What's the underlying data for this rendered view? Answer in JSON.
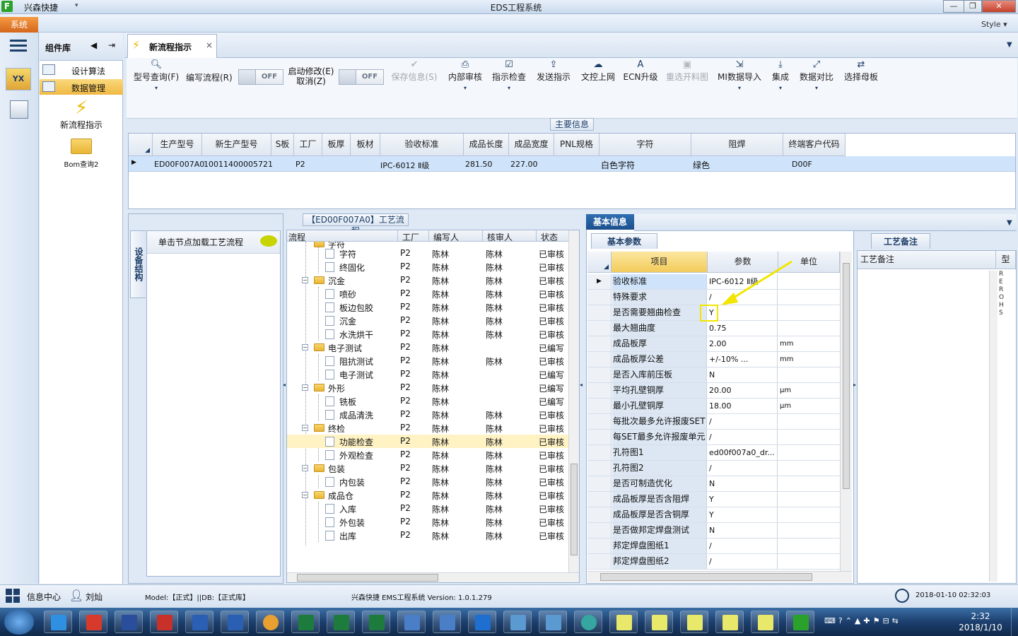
{
  "window": {
    "app_name": "兴森快捷",
    "title": "EDS工程系统",
    "btn_min": "—",
    "btn_max": "❐",
    "btn_close": "✕"
  },
  "menubar": {
    "system_label": "系统",
    "style_label": "Style"
  },
  "component_panel": {
    "title": "组件库",
    "items": [
      {
        "label": "设计算法"
      },
      {
        "label": "数据管理"
      }
    ],
    "tools": [
      {
        "label": "新流程指示"
      },
      {
        "label": "Bom查询2"
      }
    ]
  },
  "tab": {
    "label": "新流程指示",
    "close": "×"
  },
  "toolbar": {
    "buttons": [
      {
        "label": "型号查询(F)"
      },
      {
        "label": "编写流程(R)"
      },
      {
        "label": "启动修改(E)"
      },
      {
        "label": "取消(Z)"
      },
      {
        "label": "保存信息(S)"
      },
      {
        "label": "内部审核"
      },
      {
        "label": "指示检查"
      },
      {
        "label": "发送指示"
      },
      {
        "label": "文控上网"
      },
      {
        "label": "ECN升级"
      },
      {
        "label": "重选开料图"
      },
      {
        "label": "MI数据导入"
      },
      {
        "label": "集成"
      },
      {
        "label": "数据对比"
      },
      {
        "label": "选择母板"
      }
    ],
    "toggle_off": "OFF"
  },
  "main_info": {
    "caption": "主要信息",
    "columns": [
      "生产型号",
      "新生产型号",
      "S板",
      "工厂",
      "板厚",
      "板材",
      "验收标准",
      "成品长度",
      "成品宽度",
      "PNL规格",
      "字符",
      "阻焊",
      "终端客户代码"
    ],
    "row": [
      "ED00F007A0",
      "10011400005721",
      "",
      "P2",
      "",
      "",
      "IPC-6012 Ⅱ级",
      "281.50",
      "227.00",
      "",
      "白色字符",
      "绿色",
      "D00F"
    ]
  },
  "process": {
    "caption": "【ED00F007A0】工艺流程",
    "vertical_tab": "设备结构",
    "node_hint": "单击节点加载工艺流程",
    "columns": [
      "流程",
      "工厂",
      "编写人",
      "核审人",
      "状态"
    ],
    "rows": [
      {
        "name": "字符",
        "factory": "P2",
        "writer": "陈林",
        "reviewer": "陈林",
        "status": "已审核"
      },
      {
        "name": "终固化",
        "factory": "P2",
        "writer": "陈林",
        "reviewer": "陈林",
        "status": "已审核"
      },
      {
        "name": "沉金",
        "factory": "P2",
        "writer": "陈林",
        "reviewer": "陈林",
        "status": "已审核"
      },
      {
        "name": "喷砂",
        "factory": "P2",
        "writer": "陈林",
        "reviewer": "陈林",
        "status": "已审核"
      },
      {
        "name": "板边包胶",
        "factory": "P2",
        "writer": "陈林",
        "reviewer": "陈林",
        "status": "已审核"
      },
      {
        "name": "沉金",
        "factory": "P2",
        "writer": "陈林",
        "reviewer": "陈林",
        "status": "已审核"
      },
      {
        "name": "水洗烘干",
        "factory": "P2",
        "writer": "陈林",
        "reviewer": "陈林",
        "status": "已审核"
      },
      {
        "name": "电子测试",
        "factory": "P2",
        "writer": "陈林",
        "reviewer": "",
        "status": "已编写"
      },
      {
        "name": "阻抗测试",
        "factory": "P2",
        "writer": "陈林",
        "reviewer": "陈林",
        "status": "已审核"
      },
      {
        "name": "电子测试",
        "factory": "P2",
        "writer": "陈林",
        "reviewer": "",
        "status": "已编写"
      },
      {
        "name": "外形",
        "factory": "P2",
        "writer": "陈林",
        "reviewer": "",
        "status": "已编写"
      },
      {
        "name": "铣板",
        "factory": "P2",
        "writer": "陈林",
        "reviewer": "",
        "status": "已编写"
      },
      {
        "name": "成品清洗",
        "factory": "P2",
        "writer": "陈林",
        "reviewer": "陈林",
        "status": "已审核"
      },
      {
        "name": "终检",
        "factory": "P2",
        "writer": "陈林",
        "reviewer": "陈林",
        "status": "已审核"
      },
      {
        "name": "功能检查",
        "factory": "P2",
        "writer": "陈林",
        "reviewer": "陈林",
        "status": "已审核"
      },
      {
        "name": "外观检查",
        "factory": "P2",
        "writer": "陈林",
        "reviewer": "陈林",
        "status": "已审核"
      },
      {
        "name": "包装",
        "factory": "P2",
        "writer": "陈林",
        "reviewer": "陈林",
        "status": "已审核"
      },
      {
        "name": "内包装",
        "factory": "P2",
        "writer": "陈林",
        "reviewer": "陈林",
        "status": "已审核"
      },
      {
        "name": "成品仓",
        "factory": "P2",
        "writer": "陈林",
        "reviewer": "陈林",
        "status": "已审核"
      },
      {
        "name": "入库",
        "factory": "P2",
        "writer": "陈林",
        "reviewer": "陈林",
        "status": "已审核"
      },
      {
        "name": "外包装",
        "factory": "P2",
        "writer": "陈林",
        "reviewer": "陈林",
        "status": "已审核"
      },
      {
        "name": "出库",
        "factory": "P2",
        "writer": "陈林",
        "reviewer": "陈林",
        "status": "已审核"
      }
    ]
  },
  "basic_info": {
    "tab": "基本信息",
    "subtab": "基本参数",
    "columns": [
      "项目",
      "参数",
      "单位"
    ],
    "rows": [
      {
        "item": "验收标准",
        "param": "IPC-6012 Ⅱ级",
        "unit": ""
      },
      {
        "item": "特殊要求",
        "param": "/",
        "unit": ""
      },
      {
        "item": "是否需要翘曲检查",
        "param": "Y",
        "unit": ""
      },
      {
        "item": "最大翘曲度",
        "param": "0.75",
        "unit": ""
      },
      {
        "item": "成品板厚",
        "param": "2.00",
        "unit": "mm"
      },
      {
        "item": "成品板厚公差",
        "param": "+/-10%        ...",
        "unit": "mm"
      },
      {
        "item": "是否入库前压板",
        "param": "N",
        "unit": ""
      },
      {
        "item": "平均孔壁铜厚",
        "param": "20.00",
        "unit": "μm"
      },
      {
        "item": "最小孔壁铜厚",
        "param": "18.00",
        "unit": "μm"
      },
      {
        "item": "每批次最多允许报废SET",
        "param": "/",
        "unit": ""
      },
      {
        "item": "每SET最多允许报废单元",
        "param": "/",
        "unit": ""
      },
      {
        "item": "孔符图1",
        "param": "ed00f007a0_dr...",
        "unit": ""
      },
      {
        "item": "孔符图2",
        "param": "/",
        "unit": ""
      },
      {
        "item": "是否可制造优化",
        "param": "N",
        "unit": ""
      },
      {
        "item": "成品板厚是否含阻焊",
        "param": "Y",
        "unit": ""
      },
      {
        "item": "成品板厚是否含铜厚",
        "param": "Y",
        "unit": ""
      },
      {
        "item": "是否做邦定焊盘测试",
        "param": "N",
        "unit": ""
      },
      {
        "item": "邦定焊盘图纸1",
        "param": "/",
        "unit": ""
      },
      {
        "item": "邦定焊盘图纸2",
        "param": "/",
        "unit": ""
      }
    ]
  },
  "notes": {
    "tab": "工艺备注",
    "col1": "工艺备注",
    "col2": "型",
    "vertical_text": "REROHS"
  },
  "statusbar": {
    "info_center": "信息中心",
    "user": "刘灿",
    "model": "Model:【正式】||DB:【正式库】",
    "version": "兴森快捷 EMS工程系统 Version: 1.0.1.279",
    "datetime": "2018-01-10 02:32:03"
  },
  "taskbar": {
    "time": "2:32",
    "date": "2018/1/10"
  },
  "colors": {
    "accent": "#1b4f8c",
    "system_button": "#e07a2a",
    "highlight_arrow": "#f2e600",
    "selected_row": "#cfe4fb"
  }
}
